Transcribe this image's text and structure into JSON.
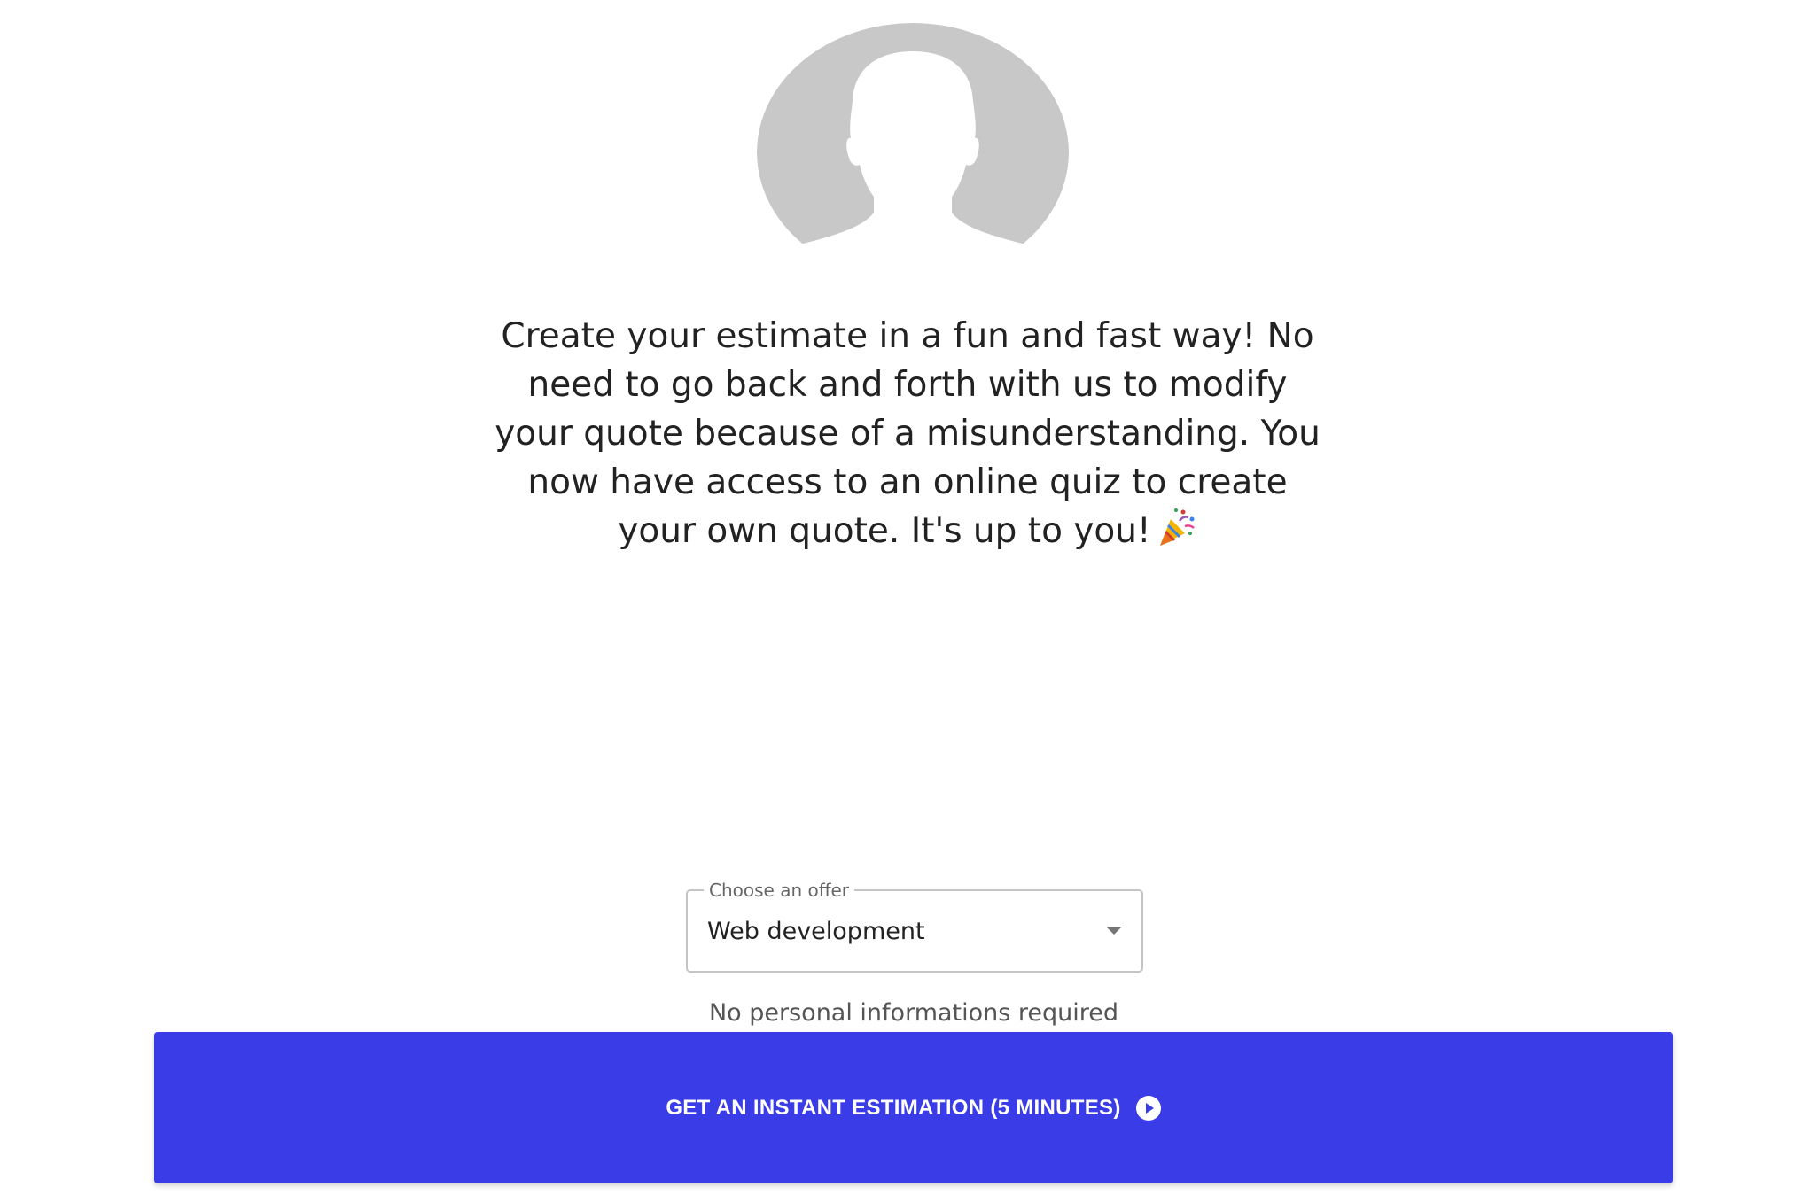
{
  "avatar": {
    "icon": "user-silhouette-icon",
    "color": "#c8c8c8"
  },
  "intro": {
    "text": "Create your estimate in a fun and fast way! No need to go back and forth with us to modify your quote because of a misunderstanding. You now have access to an online quiz to create your own quote. It's up to you!",
    "emoji_icon": "party-popper-icon"
  },
  "offer_select": {
    "label": "Choose an offer",
    "value": "Web development",
    "icon": "chevron-down-icon"
  },
  "helper_text": "No personal informations required",
  "cta": {
    "label": "GET AN INSTANT ESTIMATION (5 MINUTES)",
    "icon": "play-circle-icon",
    "color": "#3a3ce8"
  }
}
